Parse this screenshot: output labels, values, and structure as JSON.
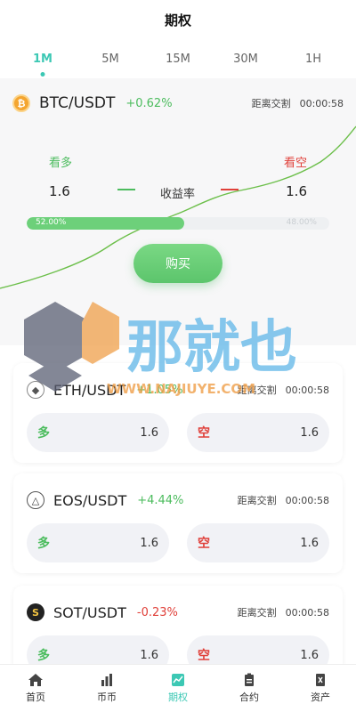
{
  "header": {
    "title": "期权"
  },
  "tabs": [
    {
      "label": "1M",
      "active": true
    },
    {
      "label": "5M",
      "active": false
    },
    {
      "label": "15M",
      "active": false
    },
    {
      "label": "30M",
      "active": false
    },
    {
      "label": "1H",
      "active": false
    }
  ],
  "main": {
    "pair": "BTC/USDT",
    "change": "+0.62%",
    "countdown_label": "距离交割",
    "countdown_value": "00:00:58",
    "long_label": "看多",
    "short_label": "看空",
    "long_value": "1.6",
    "short_value": "1.6",
    "yield_label": "收益率",
    "progress_text": "52.00%",
    "progress_text_right": "48.00%",
    "progress_value": 52,
    "buy_label": "购买",
    "colors": {
      "up": "#4cbc5e",
      "down": "#e0403a",
      "accent": "#3cc8b4"
    }
  },
  "cards": [
    {
      "pair": "ETH/USDT",
      "change": "+1.05%",
      "countdown_label": "距离交割",
      "countdown_value": "00:00:58",
      "long_label": "多",
      "long_value": "1.6",
      "short_label": "空",
      "short_value": "1.6",
      "icon": "eth-icon"
    },
    {
      "pair": "EOS/USDT",
      "change": "+4.44%",
      "countdown_label": "距离交割",
      "countdown_value": "00:00:58",
      "long_label": "多",
      "long_value": "1.6",
      "short_label": "空",
      "short_value": "1.6",
      "icon": "eos-icon"
    },
    {
      "pair": "SOT/USDT",
      "change": "-0.23%",
      "countdown_label": "距离交割",
      "countdown_value": "00:00:58",
      "long_label": "多",
      "long_value": "1.6",
      "short_label": "空",
      "short_value": "1.6",
      "icon": "sot-icon"
    }
  ],
  "watermark": {
    "text": "那就也",
    "url": "WWW.NAJIUYE.COM",
    "logo": "NY"
  },
  "nav": [
    {
      "label": "首页",
      "icon": "home-icon"
    },
    {
      "label": "币币",
      "icon": "bar-chart-icon"
    },
    {
      "label": "期权",
      "icon": "options-icon",
      "active": true
    },
    {
      "label": "合约",
      "icon": "contract-icon"
    },
    {
      "label": "资产",
      "icon": "assets-icon"
    }
  ]
}
